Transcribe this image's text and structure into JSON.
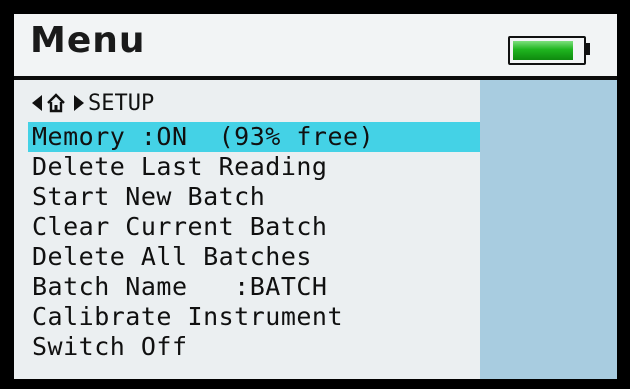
{
  "header": {
    "title": "Menu",
    "battery_level": 0.88,
    "battery_icon": "battery-icon",
    "battery_color": "#22b822"
  },
  "breadcrumb": {
    "back_icon": "triangle-left-icon",
    "home_icon": "home-icon",
    "separator_icon": "triangle-right-icon",
    "label": "SETUP"
  },
  "menu": {
    "items": [
      {
        "label": "Memory :ON  (93% free)",
        "selected": true
      },
      {
        "label": "Delete Last Reading"
      },
      {
        "label": "Start New Batch"
      },
      {
        "label": "Clear Current Batch"
      },
      {
        "label": "Delete All Batches"
      },
      {
        "label": "Batch Name   :BATCH"
      },
      {
        "label": "Calibrate Instrument"
      },
      {
        "label": "Switch Off"
      }
    ]
  },
  "colors": {
    "selection": "#44d2e6",
    "side_panel": "#a8cce0",
    "background": "#ebeff1"
  }
}
